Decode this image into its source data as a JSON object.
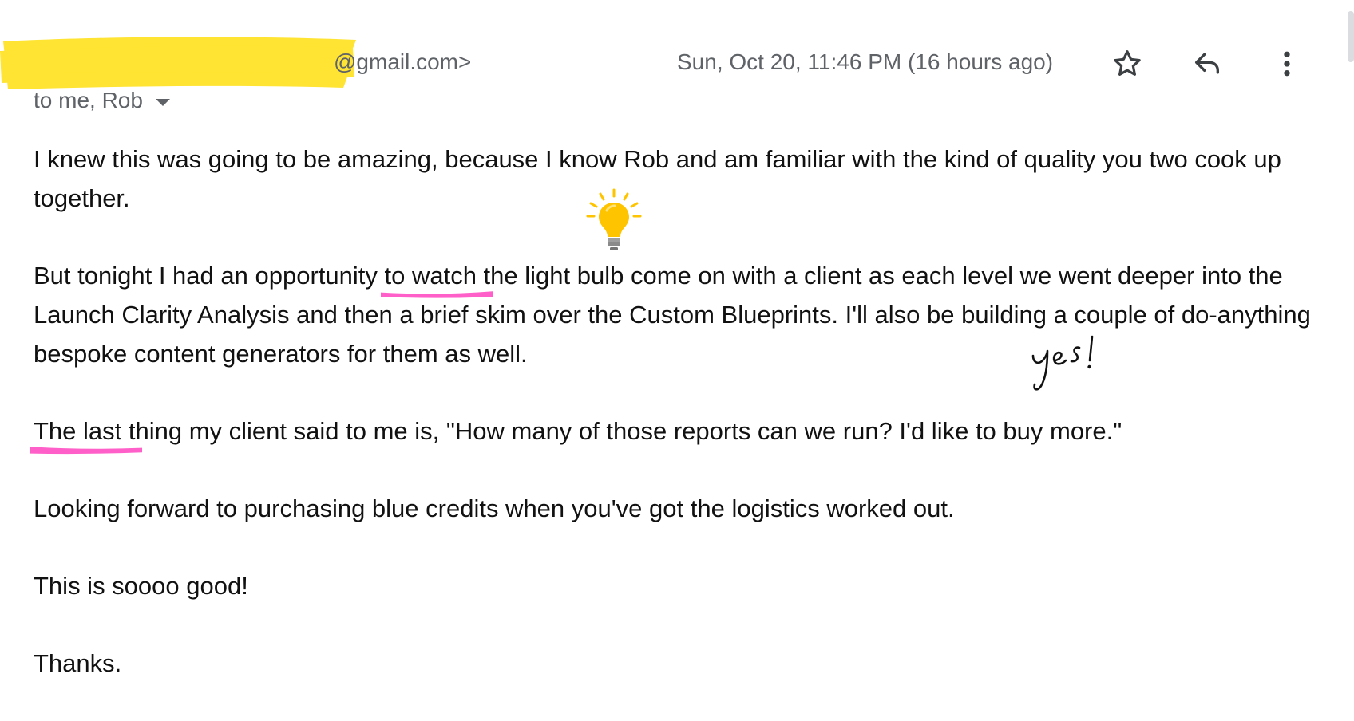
{
  "header": {
    "sender_email": "@gmail.com>",
    "recipients": "to me, Rob",
    "timestamp": "Sun, Oct 20, 11:46 PM (16 hours ago)",
    "actions": {
      "star": "star-icon",
      "reply": "reply-icon",
      "more": "more-vertical-icon"
    }
  },
  "body": {
    "p1": "I knew this was going to be amazing, because I know Rob and am familiar with the kind of quality you two cook up together.",
    "p2_before": "But tonight I had an opportunity ",
    "p2_highlight": "to watch the light bulb come on with a client",
    "p2_after": " as each level we went deeper into the Launch Clarity Analysis and then a brief skim over the Custom Blueprints. I'll also be building a couple of do-anything bespoke content generators for them as well.",
    "p3_highlight": "The last thing my client said to me is, \"How many of those reports can we run?  I'd like to buy more.\"",
    "p4": "Looking forward to purchasing blue credits when you've got the logistics worked out.",
    "p5": "This is soooo good!",
    "p6": "Thanks."
  },
  "annotations": {
    "handwritten_note": "yes!",
    "icon": "light-bulb-icon"
  },
  "colors": {
    "redaction_yellow": "#FFE433",
    "highlight_pink": "#FF5FC8",
    "bulb_yellow": "#FFC400",
    "meta_gray": "#5f6368",
    "body_text": "#111111"
  }
}
